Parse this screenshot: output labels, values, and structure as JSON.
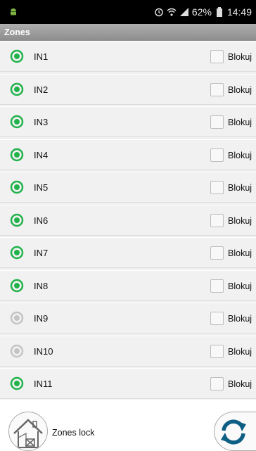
{
  "status_bar": {
    "battery": "62%",
    "time": "14:49",
    "icons": [
      "android-icon",
      "alarm-icon",
      "wifi-icon",
      "signal-icon",
      "battery-icon"
    ]
  },
  "title": "Zones",
  "checkbox_label": "Blokuj",
  "zones": [
    {
      "name": "IN1",
      "active": true
    },
    {
      "name": "IN2",
      "active": true
    },
    {
      "name": "IN3",
      "active": true
    },
    {
      "name": "IN4",
      "active": true
    },
    {
      "name": "IN5",
      "active": true
    },
    {
      "name": "IN6",
      "active": true
    },
    {
      "name": "IN7",
      "active": true
    },
    {
      "name": "IN8",
      "active": true
    },
    {
      "name": "IN9",
      "active": false
    },
    {
      "name": "IN10",
      "active": false
    },
    {
      "name": "IN11",
      "active": true
    }
  ],
  "colors": {
    "active_radio": "#22b24c",
    "inactive_radio": "#c4c4c4",
    "title_bar": "#9a9a9a",
    "refresh_icon": "#0d5f83"
  },
  "bottom": {
    "lock_label": "Zones lock",
    "lock_icon": "house-lock-icon",
    "refresh_icon": "refresh-icon"
  }
}
